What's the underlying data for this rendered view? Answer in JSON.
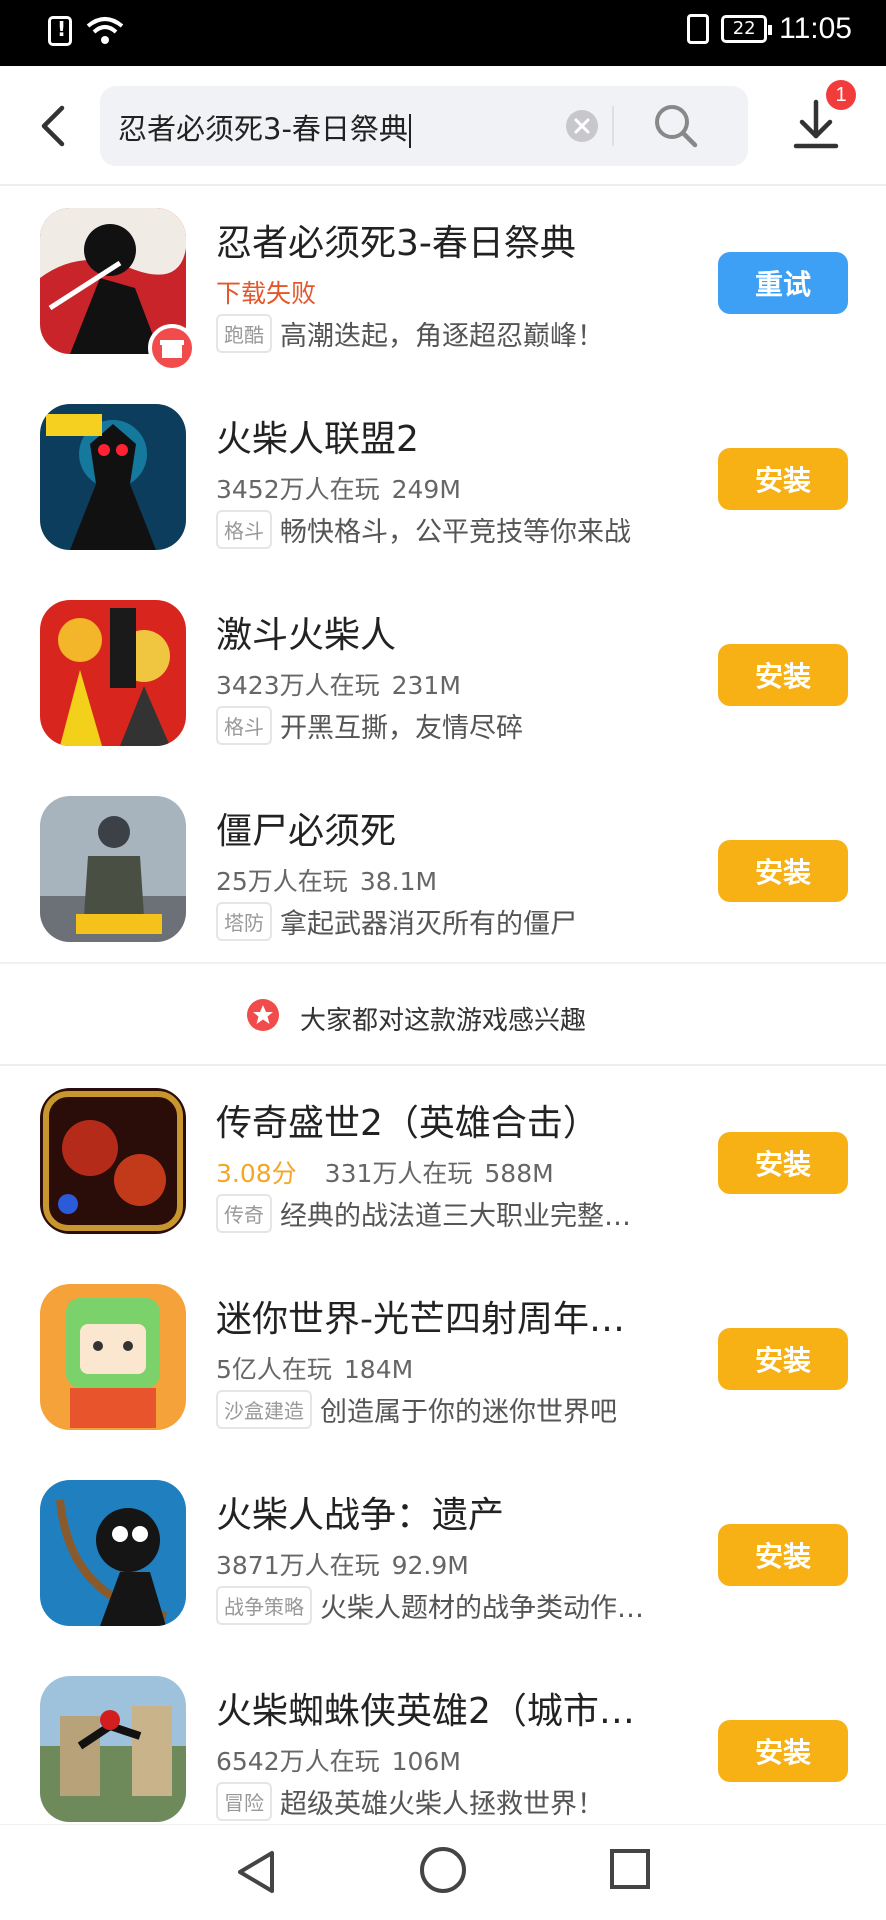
{
  "status_bar": {
    "time": "11:05",
    "battery": "22"
  },
  "header": {
    "query": "忍者必须死3-春日祭典",
    "download_badge": "1"
  },
  "apps": [
    {
      "title": "忍者必须死3-春日祭典",
      "status": "下载失败",
      "tag": "跑酷",
      "desc": "高潮迭起，角逐超忍巅峰！",
      "button": "重试"
    },
    {
      "title": "火柴人联盟2",
      "players": "3452万人在玩",
      "size": "249M",
      "tag": "格斗",
      "desc": "畅快格斗，公平竞技等你来战",
      "button": "安装"
    },
    {
      "title": "激斗火柴人",
      "players": "3423万人在玩",
      "size": "231M",
      "tag": "格斗",
      "desc": "开黑互撕，友情尽碎",
      "button": "安装"
    },
    {
      "title": "僵尸必须死",
      "players": "25万人在玩",
      "size": "38.1M",
      "tag": "塔防",
      "desc": "拿起武器消灭所有的僵尸",
      "button": "安装"
    },
    {
      "title": "传奇盛世2（英雄合击）",
      "score": "3.08分",
      "players": "331万人在玩",
      "size": "588M",
      "tag": "传奇",
      "desc": "经典的战法道三大职业完整重…",
      "button": "安装"
    },
    {
      "title": "迷你世界-光芒四射周年…",
      "players": "5亿人在玩",
      "size": "184M",
      "tag": "沙盒建造",
      "desc": "创造属于你的迷你世界吧",
      "button": "安装"
    },
    {
      "title": "火柴人战争：遗产",
      "players": "3871万人在玩",
      "size": "92.9M",
      "tag": "战争策略",
      "desc": "火柴人题材的战争类动作…",
      "button": "安装"
    },
    {
      "title": "火柴蜘蛛侠英雄2（城市…",
      "players": "6542万人在玩",
      "size": "106M",
      "tag": "冒险",
      "desc": "超级英雄火柴人拯救世界！",
      "button": "安装"
    }
  ],
  "interest_banner": "大家都对这款游戏感兴趣",
  "colors": {
    "install": "#f7b115",
    "retry": "#3da0f5",
    "fail": "#e5572a",
    "score": "#f5a623"
  }
}
